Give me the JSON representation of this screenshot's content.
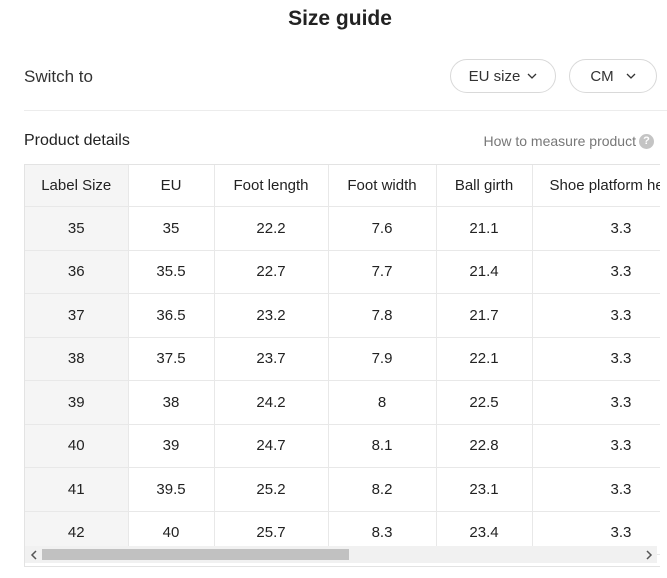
{
  "title": "Size guide",
  "switch": {
    "label": "Switch to",
    "size_selected": "EU size",
    "unit_selected": "CM"
  },
  "product_details": {
    "title": "Product details",
    "how_to_measure": "How to measure product",
    "help_icon": "?"
  },
  "table": {
    "headers": [
      "Label Size",
      "EU",
      "Foot length",
      "Foot width",
      "Ball girth",
      "Shoe platform height"
    ],
    "rows": [
      [
        "35",
        "35",
        "22.2",
        "7.6",
        "21.1",
        "3.3"
      ],
      [
        "36",
        "35.5",
        "22.7",
        "7.7",
        "21.4",
        "3.3"
      ],
      [
        "37",
        "36.5",
        "23.2",
        "7.8",
        "21.7",
        "3.3"
      ],
      [
        "38",
        "37.5",
        "23.7",
        "7.9",
        "22.1",
        "3.3"
      ],
      [
        "39",
        "38",
        "24.2",
        "8",
        "22.5",
        "3.3"
      ],
      [
        "40",
        "39",
        "24.7",
        "8.1",
        "22.8",
        "3.3"
      ],
      [
        "41",
        "39.5",
        "25.2",
        "8.2",
        "23.1",
        "3.3"
      ],
      [
        "42",
        "40",
        "25.7",
        "8.3",
        "23.4",
        "3.3"
      ]
    ]
  },
  "icons": {
    "dropdown": "chevron-down-icon",
    "help": "question-circle-icon",
    "scroll_left": "chevron-left-icon",
    "scroll_right": "chevron-right-icon"
  }
}
